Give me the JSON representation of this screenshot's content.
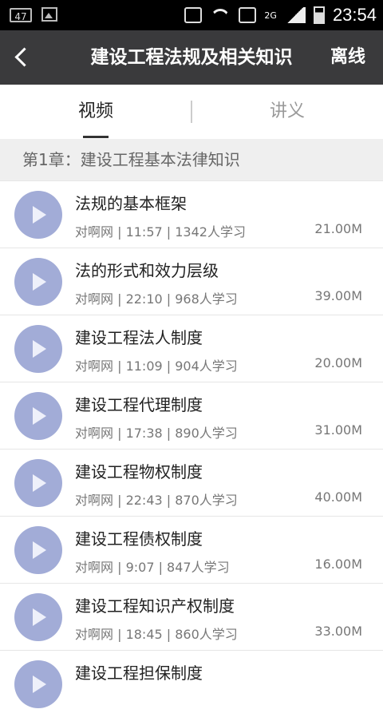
{
  "status_bar": {
    "badge": "47",
    "network": "2G",
    "time": "23:54"
  },
  "header": {
    "title": "建设工程法规及相关知识",
    "offline_label": "离线"
  },
  "tabs": [
    {
      "label": "视频"
    },
    {
      "label": "讲义"
    }
  ],
  "chapter": {
    "title": "第1章：建设工程基本法律知识"
  },
  "items": [
    {
      "title": "法规的基本框架",
      "meta": "对啊网 | 11:57 | 1342人学习",
      "size": "21.00M"
    },
    {
      "title": "法的形式和效力层级",
      "meta": "对啊网 | 22:10 | 968人学习",
      "size": "39.00M"
    },
    {
      "title": "建设工程法人制度",
      "meta": "对啊网 | 11:09 | 904人学习",
      "size": "20.00M"
    },
    {
      "title": "建设工程代理制度",
      "meta": "对啊网 | 17:38 | 890人学习",
      "size": "31.00M"
    },
    {
      "title": "建设工程物权制度",
      "meta": "对啊网 | 22:43 | 870人学习",
      "size": "40.00M"
    },
    {
      "title": "建设工程债权制度",
      "meta": "对啊网 | 9:07 | 847人学习",
      "size": "16.00M"
    },
    {
      "title": "建设工程知识产权制度",
      "meta": "对啊网 | 18:45 | 860人学习",
      "size": "33.00M"
    },
    {
      "title": "建设工程担保制度",
      "meta": "",
      "size": ""
    }
  ],
  "colors": {
    "titlebar": "#3a3a3c",
    "play_icon": "#a2acd7"
  },
  "icons": [
    "back-arrow-icon",
    "play-icon",
    "wifi-icon",
    "signal-icon",
    "battery-icon",
    "vibrate-icon",
    "image-icon"
  ]
}
